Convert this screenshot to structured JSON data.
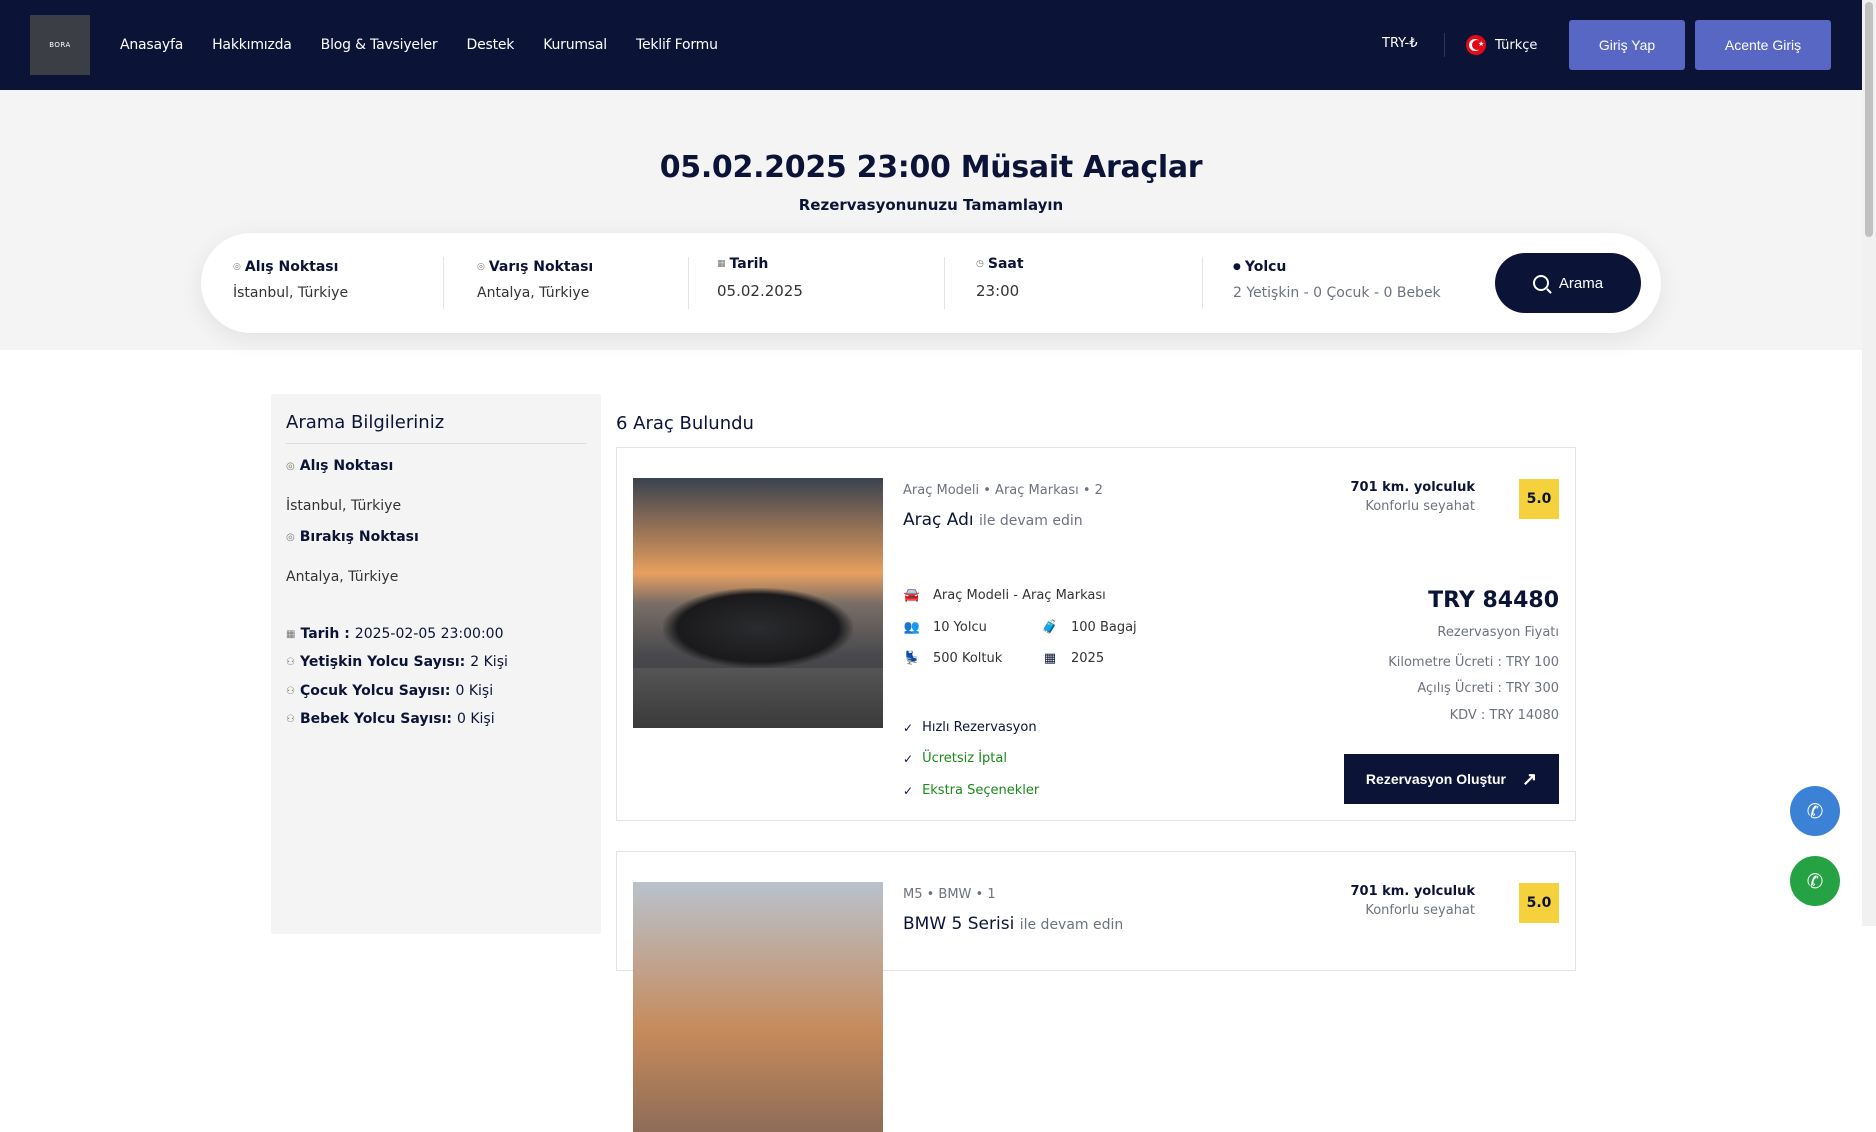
{
  "nav": {
    "logo_text": "BORA",
    "links": [
      "Anasayfa",
      "Hakkımızda",
      "Blog & Tavsiyeler",
      "Destek",
      "Kurumsal",
      "Teklif Formu"
    ],
    "currency": "TRY-₺",
    "language": "Türkçe",
    "login_label": "Giriş Yap",
    "agent_label": "Acente Giriş"
  },
  "hero": {
    "title": "05.02.2025 23:00 Müsait Araçlar",
    "subtitle": "Rezervasyonunuzu Tamamlayın"
  },
  "search": {
    "pickup_label": "Alış Noktası",
    "pickup_value": "İstanbul, Türkiye",
    "dropoff_label": "Varış Noktası",
    "dropoff_value": "Antalya, Türkiye",
    "date_label": "Tarih",
    "date_value": "05.02.2025",
    "time_label": "Saat",
    "time_value": "23:00",
    "passenger_label": "Yolcu",
    "passenger_value": "2 Yetişkin - 0 Çocuk - 0 Bebek",
    "button_label": "Arama"
  },
  "sidebar": {
    "title": "Arama Bilgileriniz",
    "pickup_label": "Alış Noktası",
    "pickup_value": "İstanbul, Türkiye",
    "dropoff_label": "Bırakış Noktası",
    "dropoff_value": "Antalya, Türkiye",
    "date_label": "Tarih :",
    "date_value": "2025-02-05 23:00:00",
    "adult_label": "Yetişkin Yolcu Sayısı:",
    "adult_value": "2 Kişi",
    "child_label": "Çocuk Yolcu Sayısı:",
    "child_value": "0 Kişi",
    "baby_label": "Bebek Yolcu Sayısı:",
    "baby_value": "0 Kişi"
  },
  "results": {
    "count_label": "6 Araç Bulundu",
    "cards": [
      {
        "meta": "Araç Modeli • Araç Markası • 2",
        "name": "Araç Adı",
        "name_suffix": "ile devam edin",
        "km": "701 km. yolculuk",
        "km_sub": "Konforlu seyahat",
        "rating": "5.0",
        "model_brand": "Araç Modeli - Araç Markası",
        "passengers": "10 Yolcu",
        "luggage": "100 Bagaj",
        "seats": "500 Koltuk",
        "year": "2025",
        "price": "TRY 84480",
        "price_label": "Rezervasyon Fiyatı",
        "km_fee": "Kilometre Ücreti : TRY 100",
        "opening_fee": "Açılış Ücreti : TRY 300",
        "vat": "KDV : TRY 14080",
        "features": [
          "Hızlı Rezervasyon",
          "Ücretsiz İptal",
          "Ekstra Seçenekler"
        ],
        "book_label": "Rezervasyon Oluştur"
      },
      {
        "meta": "M5 • BMW • 1",
        "name": "BMW 5 Serisi",
        "name_suffix": "ile devam edin",
        "km": "701 km. yolculuk",
        "km_sub": "Konforlu seyahat",
        "rating": "5.0"
      }
    ]
  },
  "colors": {
    "navy": "#0b1437",
    "accent": "#5867c4",
    "rating": "#f5d13d",
    "green": "#1a8a1a"
  }
}
